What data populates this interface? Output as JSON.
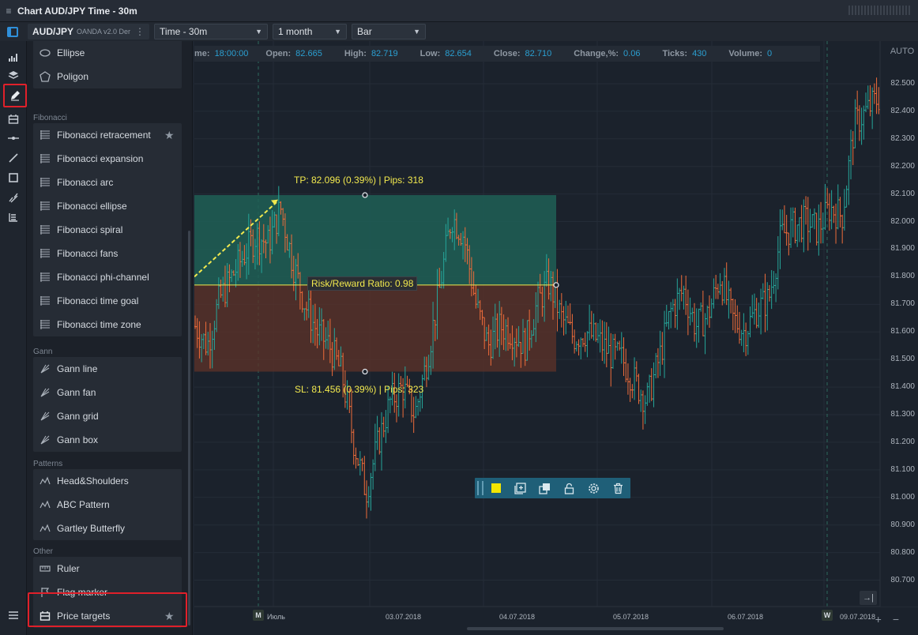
{
  "window": {
    "title": "Chart AUD/JPY Time - 30m"
  },
  "toolbar": {
    "symbol": "AUD/JPY",
    "source": "OANDA v2.0 Der",
    "symbol_menu": "⋮",
    "timeframe": "Time - 30m",
    "period": "1 month",
    "chart_type": "Bar"
  },
  "left_strip": {
    "icons": [
      "bar-chart-icon",
      "layers-icon",
      "pencil-icon",
      "price-targets-icon",
      "horizontal-line-icon",
      "trend-line-icon",
      "rectangle-icon",
      "fibonacci-icon",
      "gann-icon",
      "list-icon"
    ]
  },
  "tools_panel": {
    "top_items": [
      {
        "label": "Ellipse",
        "icon": "ellipse-icon"
      },
      {
        "label": "Poligon",
        "icon": "polygon-icon"
      }
    ],
    "sections": [
      {
        "label": "Fibonacci",
        "items": [
          {
            "label": "Fibonacci retracement",
            "icon": "fib-retracement-icon",
            "starred": true
          },
          {
            "label": "Fibonacci expansion",
            "icon": "fib-expansion-icon"
          },
          {
            "label": "Fibonacci arc",
            "icon": "fib-arc-icon"
          },
          {
            "label": "Fibonacci ellipse",
            "icon": "fib-ellipse-icon"
          },
          {
            "label": "Fibonacci spiral",
            "icon": "fib-spiral-icon"
          },
          {
            "label": "Fibonacci fans",
            "icon": "fib-fans-icon"
          },
          {
            "label": "Fibonacci phi-channel",
            "icon": "fib-phi-channel-icon"
          },
          {
            "label": "Fibonacci time goal",
            "icon": "fib-time-goal-icon"
          },
          {
            "label": "Fibonacci time zone",
            "icon": "fib-time-zone-icon"
          }
        ]
      },
      {
        "label": "Gann",
        "items": [
          {
            "label": "Gann line",
            "icon": "gann-line-icon"
          },
          {
            "label": "Gann fan",
            "icon": "gann-fan-icon"
          },
          {
            "label": "Gann grid",
            "icon": "gann-grid-icon"
          },
          {
            "label": "Gann box",
            "icon": "gann-box-icon"
          }
        ]
      },
      {
        "label": "Patterns",
        "items": [
          {
            "label": "Head&Shoulders",
            "icon": "head-shoulders-icon"
          },
          {
            "label": "ABC Pattern",
            "icon": "abc-pattern-icon"
          },
          {
            "label": "Gartley Butterfly",
            "icon": "gartley-butterfly-icon"
          }
        ]
      },
      {
        "label": "Other",
        "items": [
          {
            "label": "Ruler",
            "icon": "ruler-icon"
          },
          {
            "label": "Flag marker",
            "icon": "flag-icon"
          },
          {
            "label": "Price targets",
            "icon": "price-targets-icon",
            "starred": true,
            "highlighted": true
          }
        ]
      }
    ]
  },
  "chart": {
    "info": {
      "time_label": "me:",
      "time_value": "18:00:00",
      "open_label": "Open:",
      "open_value": "82.665",
      "high_label": "High:",
      "high_value": "82.719",
      "low_label": "Low:",
      "low_value": "82.654",
      "close_label": "Close:",
      "close_value": "82.710",
      "change_label": "Change,%:",
      "change_value": "0.06",
      "ticks_label": "Ticks:",
      "ticks_value": "430",
      "volume_label": "Volume:",
      "volume_value": "0"
    },
    "auto_label": "AUTO",
    "y_ticks": [
      "82.500",
      "82.400",
      "82.300",
      "82.200",
      "82.100",
      "82.000",
      "81.900",
      "81.800",
      "81.700",
      "81.600",
      "81.500",
      "81.400",
      "81.300",
      "81.200",
      "81.100",
      "81.000",
      "80.900",
      "80.800",
      "80.700"
    ],
    "x_labels": [
      "Июль",
      "03.07.2018",
      "04.07.2018",
      "05.07.2018",
      "06.07.2018",
      "09.07.2018"
    ],
    "markers": [
      "M",
      "W"
    ],
    "price_targets": {
      "tp_label": "TP: 82.096 (0.39%) | Pips: 318",
      "sl_label": "SL: 81.456 (0.39%) | Pips: 323",
      "rr_label": "Risk/Reward Ratio: 0.98",
      "entry_price": 81.77,
      "tp_price": 82.096,
      "sl_price": 81.456
    },
    "colors": {
      "up": "#26a69a",
      "down": "#ef6c3a",
      "target": "#f2e94e",
      "profit_zone": "#1f5f56",
      "loss_zone": "#5a3229"
    },
    "drawing_toolbar": [
      "color-swatch-icon",
      "add-icon",
      "duplicate-icon",
      "lock-icon",
      "settings-icon",
      "trash-icon"
    ]
  },
  "chart_data": {
    "type": "bar",
    "title": "AUD/JPY",
    "ylim": [
      80.65,
      82.58
    ],
    "y_ticks": [
      82.5,
      82.4,
      82.3,
      82.2,
      82.1,
      82.0,
      81.9,
      81.8,
      81.7,
      81.6,
      81.5,
      81.4,
      81.3,
      81.2,
      81.1,
      81.0,
      80.9,
      80.8,
      80.7
    ],
    "x_tick_labels": [
      "Июль",
      "03.07.2018",
      "04.07.2018",
      "05.07.2018",
      "06.07.2018",
      "09.07.2018"
    ],
    "close_path": [
      81.62,
      81.55,
      81.72,
      81.8,
      81.88,
      81.95,
      81.92,
      82.05,
      81.85,
      81.7,
      81.6,
      81.55,
      81.45,
      81.2,
      81.02,
      81.2,
      81.35,
      81.4,
      81.3,
      81.5,
      81.75,
      82.02,
      81.95,
      81.7,
      81.55,
      81.62,
      81.6,
      81.55,
      81.7,
      81.78,
      81.65,
      81.58,
      81.6,
      81.57,
      81.52,
      81.5,
      81.42,
      81.35,
      81.5,
      81.68,
      81.75,
      81.62,
      81.66,
      81.8,
      81.65,
      81.6,
      81.68,
      81.72,
      81.95,
      81.98,
      82.0,
      81.97,
      82.05,
      82.02,
      82.35,
      82.4,
      82.45
    ]
  }
}
